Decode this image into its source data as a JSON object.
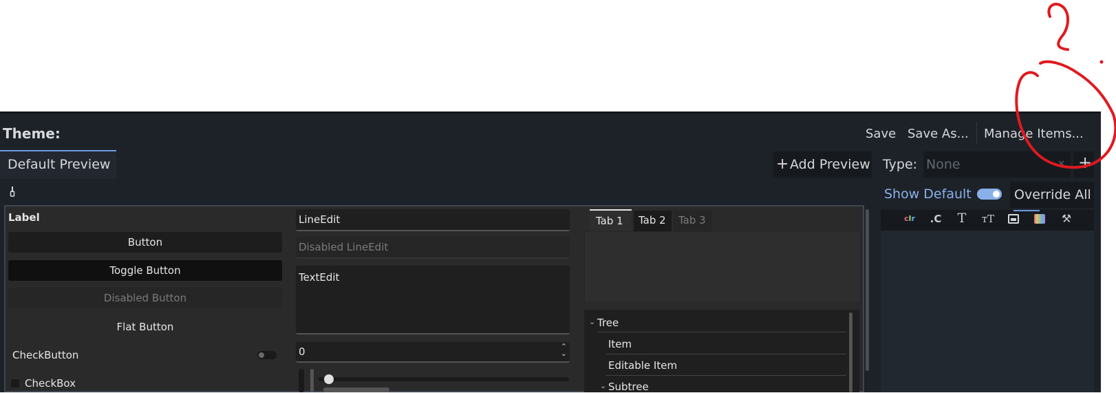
{
  "header": {
    "theme_label": "Theme:",
    "save_label": "Save",
    "save_as_label": "Save As...",
    "manage_items_label": "Manage Items..."
  },
  "tabs": {
    "default_preview": "Default Preview",
    "add_preview_icon": "+",
    "add_preview_label": "Add Preview"
  },
  "type_row": {
    "type_label": "Type:",
    "type_placeholder": "None",
    "clear_icon": "✕",
    "add_icon": "+"
  },
  "options": {
    "show_default_label": "Show Default",
    "show_default_on": true,
    "override_all_label": "Override All"
  },
  "item_type_icons": [
    "color-icon",
    "constant-icon",
    "font-icon",
    "font-size-icon",
    "icon-icon",
    "stylebox-icon",
    "theme-type-icon"
  ],
  "preview": {
    "picker_icon": "eyedropper-icon",
    "label": "Label",
    "button": "Button",
    "toggle_button": "Toggle Button",
    "disabled_button": "Disabled Button",
    "flat_button": "Flat Button",
    "check_button": "CheckButton",
    "check_box": "CheckBox",
    "line_edit": "LineEdit",
    "disabled_line_edit": "Disabled LineEdit",
    "text_edit": "TextEdit",
    "spin_value": "0",
    "tab_1": "Tab 1",
    "tab_2": "Tab 2",
    "tab_3": "Tab 3",
    "tree_root": "Tree",
    "tree_item": "Item",
    "tree_editable": "Editable Item",
    "tree_subtree": "Subtree"
  },
  "colors": {
    "annotation": "#e0191e",
    "accent": "#6c9be0",
    "panel": "#1d2229"
  }
}
